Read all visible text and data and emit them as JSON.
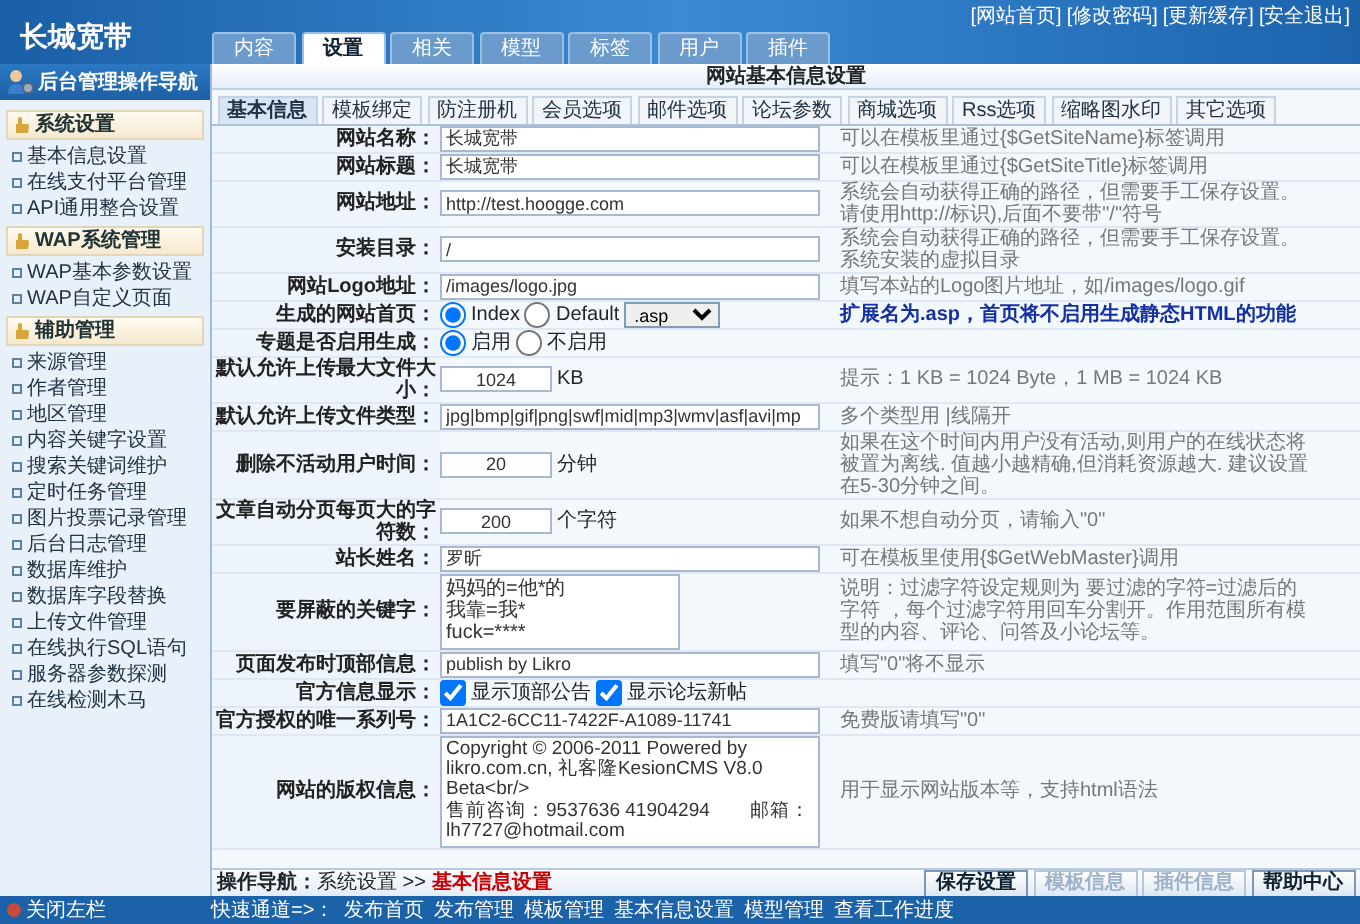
{
  "header": {
    "logo": "长城宽带",
    "top_links": [
      "[网站首页]",
      "[修改密码]",
      "[更新缓存]",
      "[安全退出]"
    ],
    "tabs": [
      {
        "label": "内容",
        "selected": false
      },
      {
        "label": "设置",
        "selected": true
      },
      {
        "label": "相关",
        "selected": false
      },
      {
        "label": "模型",
        "selected": false
      },
      {
        "label": "标签",
        "selected": false
      },
      {
        "label": "用户",
        "selected": false
      },
      {
        "label": "插件",
        "selected": false
      }
    ]
  },
  "sidebar": {
    "title": "后台管理操作导航",
    "sections": [
      {
        "title": "系统设置",
        "items": [
          "基本信息设置",
          "在线支付平台管理",
          "API通用整合设置"
        ]
      },
      {
        "title": "WAP系统管理",
        "items": [
          "WAP基本参数设置",
          "WAP自定义页面"
        ]
      },
      {
        "title": "辅助管理",
        "items": [
          "来源管理",
          "作者管理",
          "地区管理",
          "内容关键字设置",
          "搜索关键词维护",
          "定时任务管理",
          "图片投票记录管理",
          "后台日志管理",
          "数据库维护",
          "数据库字段替换",
          "上传文件管理",
          "在线执行SQL语句",
          "服务器参数探测",
          "在线检测木马"
        ]
      }
    ]
  },
  "panel": {
    "title": "网站基本信息设置",
    "subtabs": [
      {
        "label": "基本信息",
        "selected": true
      },
      {
        "label": "模板绑定",
        "selected": false
      },
      {
        "label": "防注册机",
        "selected": false
      },
      {
        "label": "会员选项",
        "selected": false
      },
      {
        "label": "邮件选项",
        "selected": false
      },
      {
        "label": "论坛参数",
        "selected": false
      },
      {
        "label": "商城选项",
        "selected": false
      },
      {
        "label": "Rss选项",
        "selected": false
      },
      {
        "label": "缩略图水印",
        "selected": false
      },
      {
        "label": "其它选项",
        "selected": false
      }
    ],
    "rows": [
      {
        "kind": "text",
        "label": "网站名称：",
        "value": "长城宽带",
        "hint": "可以在模板里通过{$GetSiteName}标签调用"
      },
      {
        "kind": "text",
        "label": "网站标题：",
        "value": "长城宽带",
        "hint": "可以在模板里通过{$GetSiteTitle}标签调用"
      },
      {
        "kind": "text",
        "label": "网站地址：",
        "value": "http://test.hoogge.com",
        "hint": "系统会自动获得正确的路径，但需要手工保存设置。请使用http://标识),后面不要带\"/\"符号"
      },
      {
        "kind": "text",
        "label": "安装目录：",
        "value": "/",
        "hint": "系统会自动获得正确的路径，但需要手工保存设置。系统安装的虚拟目录"
      },
      {
        "kind": "text",
        "label": "网站Logo地址：",
        "value": "/images/logo.jpg",
        "hint": "填写本站的Logo图片地址，如/images/logo.gif"
      },
      {
        "kind": "radio",
        "label": "生成的网站首页：",
        "options": [
          {
            "label": "Index",
            "selected": true
          },
          {
            "label": "Default",
            "selected": false
          }
        ],
        "select": ".asp",
        "hint": "扩展名为.asp，首页将不启用生成静态HTML的功能",
        "hint_emphasis": true
      },
      {
        "kind": "radio",
        "label": "专题是否启用生成：",
        "options": [
          {
            "label": "启用",
            "selected": true
          },
          {
            "label": "不启用",
            "selected": false
          }
        ]
      },
      {
        "kind": "number",
        "label": "默认允许上传最大文件大小：",
        "value": "1024",
        "unit": "KB",
        "hint": "提示：1 KB = 1024 Byte，1 MB = 1024 KB"
      },
      {
        "kind": "text",
        "label": "默认允许上传文件类型：",
        "value": "jpg|bmp|gif|png|swf|mid|mp3|wmv|asf|avi|mp",
        "hint": "多个类型用 |线隔开"
      },
      {
        "kind": "number",
        "label": "删除不活动用户时间：",
        "value": "20",
        "unit": "分钟",
        "hint": "如果在这个时间内用户没有活动,则用户的在线状态将被置为离线. 值越小越精确,但消耗资源越大. 建议设置在5-30分钟之间。"
      },
      {
        "kind": "number",
        "label": "文章自动分页每页大的字符数：",
        "value": "200",
        "unit": "个字符",
        "hint": "如果不想自动分页，请输入\"0\""
      },
      {
        "kind": "text",
        "label": "站长姓名：",
        "value": "罗昕",
        "hint": "可在模板里使用{$GetWebMaster}调用"
      },
      {
        "kind": "textarea",
        "label": "要屏蔽的关键字：",
        "lines": [
          "妈妈的=他*的",
          "我靠=我*",
          "fuck=****"
        ],
        "hint": "说明：过滤字符设定规则为 要过滤的字符=过滤后的字符 ，每个过滤字符用回车分割开。作用范围所有模型的内容、评论、问答及小论坛等。"
      },
      {
        "kind": "text",
        "label": "页面发布时顶部信息：",
        "value": "publish by Likro",
        "hint": "填写\"0\"将不显示"
      },
      {
        "kind": "checkbox",
        "label": "官方信息显示：",
        "options": [
          {
            "label": "显示顶部公告",
            "selected": true
          },
          {
            "label": "显示论坛新帖",
            "selected": true
          }
        ]
      },
      {
        "kind": "text",
        "label": "官方授权的唯一系列号：",
        "value": "1A1C2-6CC11-7422F-A1089-11741",
        "hint": "免费版请填写\"0\""
      },
      {
        "kind": "wide-textarea",
        "label": "网站的版权信息：",
        "lines": [
          "Copyright © 2006-2011 Powered by likro.com.cn, 礼客隆KesionCMS V8.0 Beta<br/>",
          "售前咨询：9537636 41904294　　邮箱：lh7727@hotmail.com"
        ],
        "hint": "用于显示网站版本等，支持html语法"
      }
    ],
    "breadcrumb": {
      "label": "操作导航：",
      "path": "系统设置 >> ",
      "current": "基本信息设置"
    },
    "buttons": [
      {
        "label": "保存设置",
        "disabled": false
      },
      {
        "label": "模板信息",
        "disabled": true
      },
      {
        "label": "插件信息",
        "disabled": true
      },
      {
        "label": "帮助中心",
        "disabled": false
      }
    ]
  },
  "footer": {
    "close_label": "关闭左栏",
    "quick_label": "快速通道=>：",
    "links": [
      "发布首页",
      "发布管理",
      "模板管理",
      "基本信息设置",
      "模型管理",
      "查看工作进度"
    ]
  }
}
